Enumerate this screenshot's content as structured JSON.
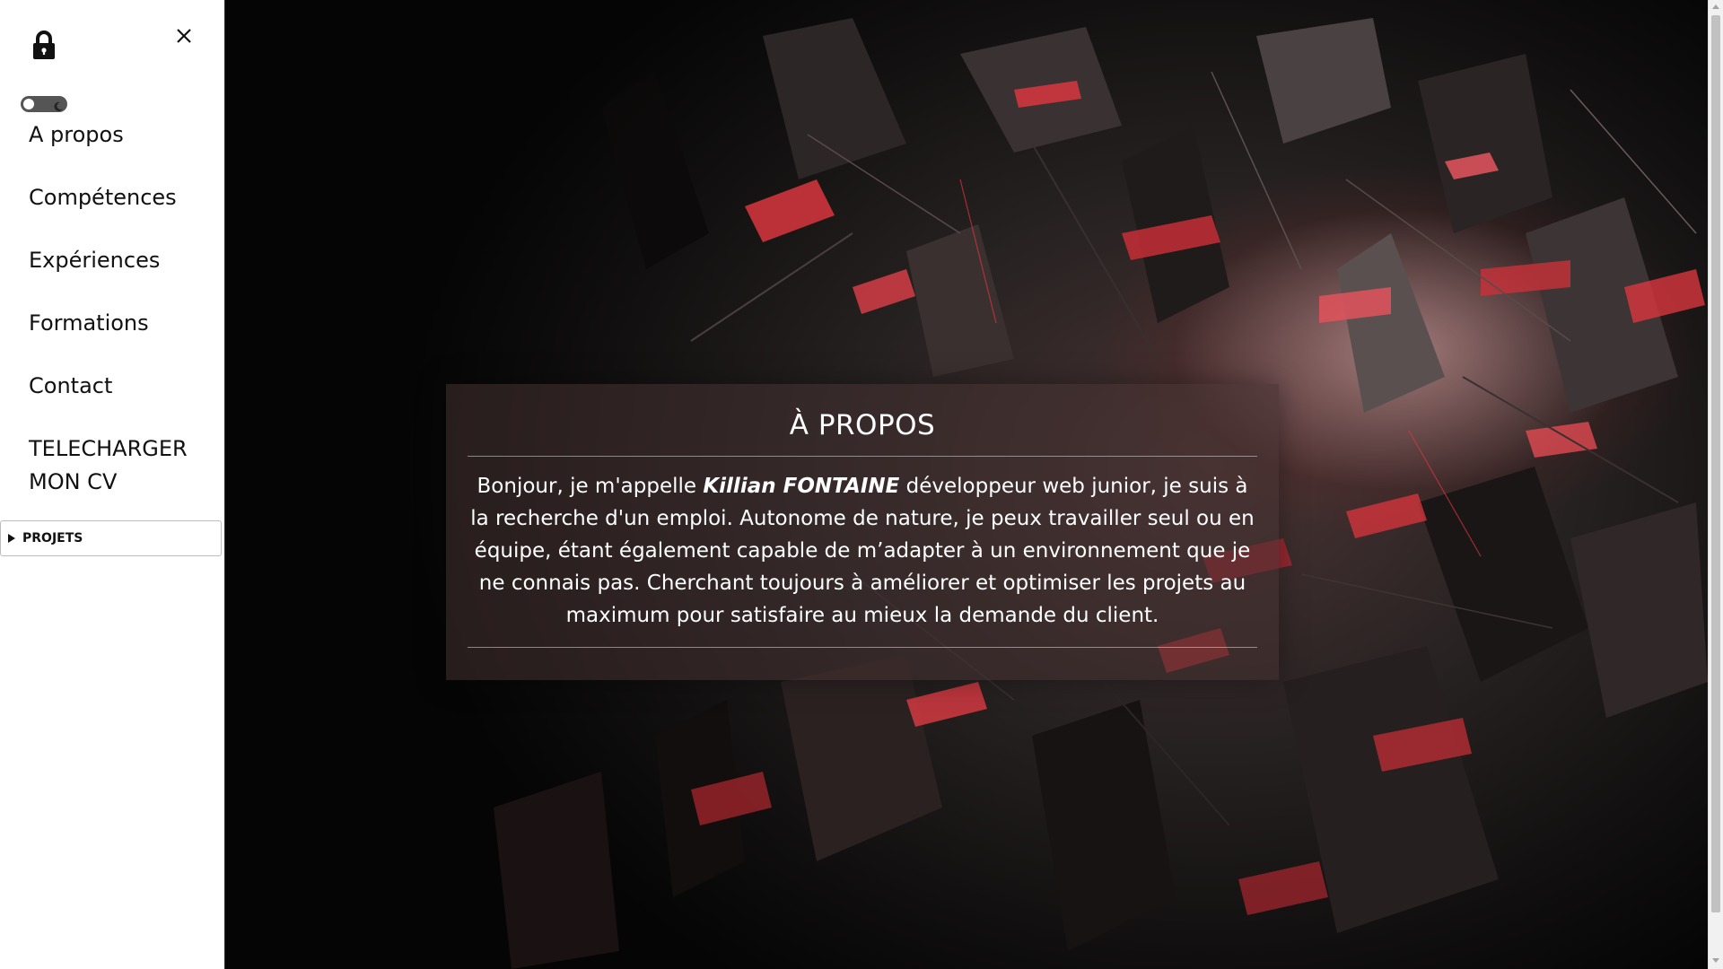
{
  "sidebar": {
    "lock_icon": "lock-icon",
    "close_icon": "close-icon",
    "theme_toggle_icon": "moon-icon",
    "nav": [
      {
        "label": "A propos"
      },
      {
        "label": "Compétences"
      },
      {
        "label": "Expériences"
      },
      {
        "label": "Formations"
      },
      {
        "label": "Contact"
      },
      {
        "label": "TELECHARGER MON CV"
      }
    ],
    "projets_label": "PROJETS"
  },
  "main": {
    "title": "À PROPOS",
    "intro_before": "Bonjour, je m'appelle ",
    "name": "Killian FONTAINE",
    "intro_after": " développeur web junior, je suis à la recherche d'un emploi. Autonome de nature, je peux travailler seul ou en équipe, étant également capable de m’adapter à un environnement que je ne connais pas. Cherchant toujours à améliorer et optimiser les projets au maximum pour satisfaire au mieux la demande du client."
  },
  "colors": {
    "accent_red": "#d9363e",
    "card_background": "#46323280",
    "sidebar_background": "#ffffff"
  }
}
